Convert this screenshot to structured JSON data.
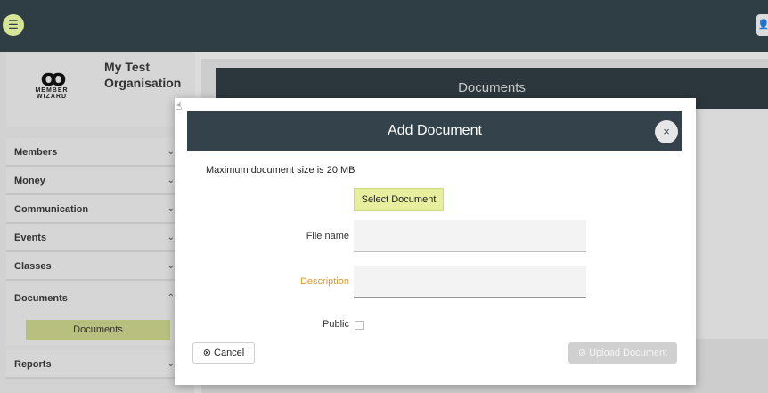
{
  "topbar": {
    "menu_icon": "☰",
    "user_icon": "👤"
  },
  "organisation": {
    "name": "My Test Organisation",
    "logo_mark": "ꝏ",
    "logo_text_1": "MEMBER",
    "logo_text_2": "WIZARD"
  },
  "sidebar": {
    "items": [
      {
        "label": "Members",
        "chevron": "⌄"
      },
      {
        "label": "Money",
        "chevron": "⌄"
      },
      {
        "label": "Communication",
        "chevron": "⌄"
      },
      {
        "label": "Events",
        "chevron": "⌄"
      },
      {
        "label": "Classes",
        "chevron": "⌄"
      },
      {
        "label": "Documents",
        "chevron": "⌃"
      },
      {
        "label": "Reports",
        "chevron": "⌄"
      }
    ],
    "sub_item": "Documents"
  },
  "main": {
    "page_title": "Documents"
  },
  "modal": {
    "title": "Add Document",
    "close_icon": "×",
    "max_size_text": "Maximum document size is 20 MB",
    "select_button": "Select Document",
    "file_name_label": "File name",
    "description_label": "Description",
    "public_label": "Public",
    "cancel_button": "⊗ Cancel",
    "upload_button": "⊘ Upload Document",
    "description_label_color": "#e49a2b"
  },
  "colors": {
    "header": "#34434b",
    "accent": "#e7ee9e",
    "topbar": "#2f3d45"
  }
}
